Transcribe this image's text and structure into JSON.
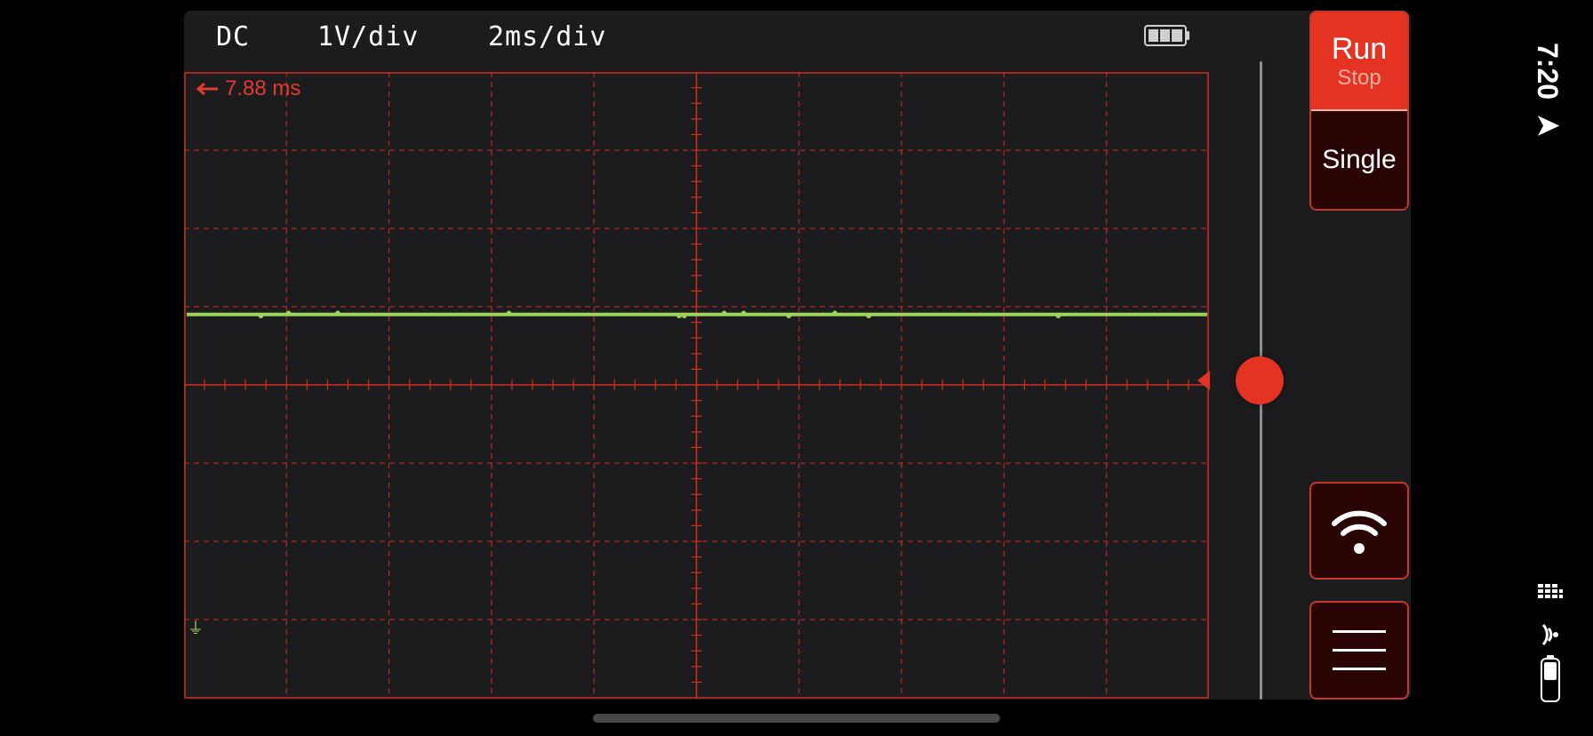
{
  "header": {
    "coupling": "DC",
    "volts_per_div": "1V/div",
    "time_per_div": "2ms/div"
  },
  "screen": {
    "time_offset": "7.88 ms",
    "ground_symbol": "⏚"
  },
  "controls": {
    "run_label": "Run",
    "stop_label": "Stop",
    "single_label": "Single"
  },
  "status": {
    "time": "7:20"
  },
  "colors": {
    "grid": "#d22d22",
    "trace": "#9fd45a",
    "accent": "#e43223"
  }
}
